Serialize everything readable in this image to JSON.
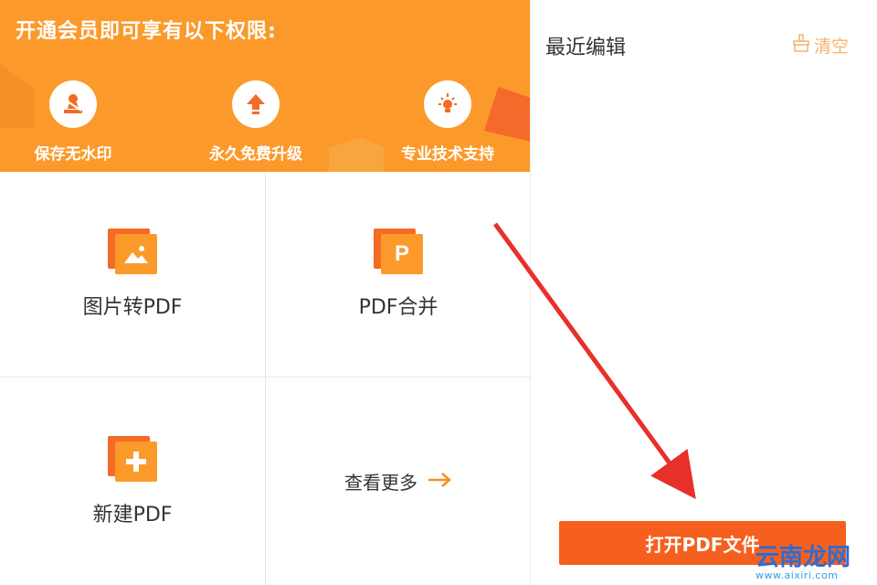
{
  "banner": {
    "title": "开通会员即可享有以下权限:",
    "perks": [
      {
        "label": "保存无水印",
        "icon": "stamp-icon"
      },
      {
        "label": "永久免费升级",
        "icon": "upgrade-arrow-icon"
      },
      {
        "label": "专业技术支持",
        "icon": "support-lightbulb-icon"
      }
    ],
    "color": "#fb9a2b"
  },
  "tools": [
    {
      "label": "图片转PDF",
      "icon": "image-icon"
    },
    {
      "label": "PDF合并",
      "icon": "pdf-merge-icon",
      "glyph": "P"
    },
    {
      "label": "新建PDF",
      "icon": "plus-icon"
    }
  ],
  "more": {
    "label": "查看更多",
    "icon": "arrow-right-icon"
  },
  "recent": {
    "title": "最近编辑",
    "clear_label": "清空"
  },
  "open_button": {
    "label": "打开PDF文件",
    "color": "#f5601e"
  },
  "watermark": {
    "main": "云南龙网",
    "sub": "www.aixiri.com"
  },
  "colors": {
    "accent": "#f5601e",
    "orange": "#fb9a2b",
    "arrow": "#e8302a"
  }
}
